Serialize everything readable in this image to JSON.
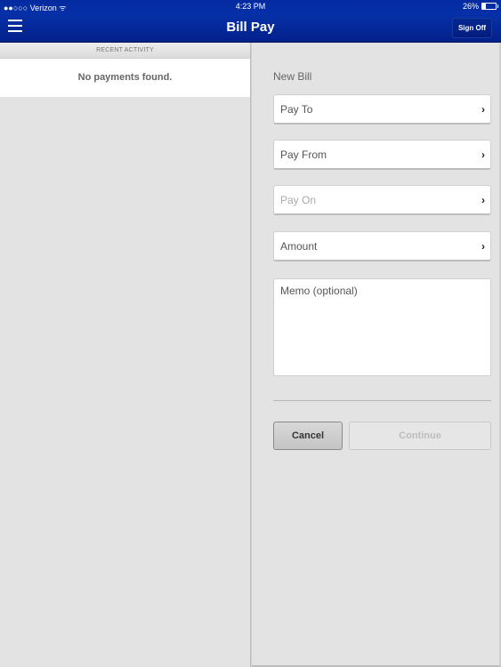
{
  "status_bar": {
    "carrier": "●●○○○ Verizon ᯤ",
    "time": "4:23 PM",
    "battery_label": "26%",
    "battery_level": 0.26
  },
  "header": {
    "menu_icon": "hamburger-menu-icon",
    "title": "Bill Pay",
    "sign_off_label": "Sign Off"
  },
  "recent_activity": {
    "header": "RECENT ACTIVITY",
    "empty_message": "No payments found."
  },
  "new_bill": {
    "heading": "New Bill",
    "fields": [
      {
        "label": "Pay To",
        "icon": "chevron-right-icon"
      },
      {
        "label": "Pay From",
        "icon": "chevron-right-icon"
      },
      {
        "label": "Pay On",
        "icon": "chevron-right-icon"
      },
      {
        "label": "Amount",
        "icon": "chevron-right-icon"
      }
    ],
    "memo_placeholder": "Memo (optional)",
    "cancel_label": "Cancel",
    "continue_label": "Continue"
  },
  "colors": {
    "header_blue": "#0630a8",
    "background": "#e3e3e3"
  }
}
